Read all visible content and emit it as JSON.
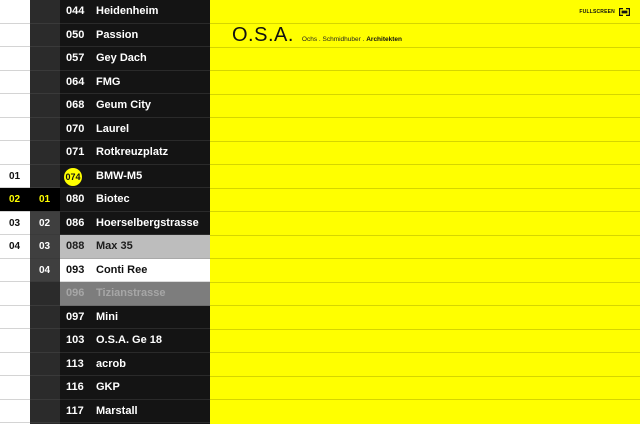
{
  "index_col1": [
    "01",
    "02",
    "03",
    "04"
  ],
  "index_col2": [
    "01",
    "02",
    "03",
    "04"
  ],
  "projects": [
    {
      "num": "044",
      "name": "Heidenheim"
    },
    {
      "num": "050",
      "name": "Passion"
    },
    {
      "num": "057",
      "name": "Gey Dach"
    },
    {
      "num": "064",
      "name": "FMG"
    },
    {
      "num": "068",
      "name": "Geum City"
    },
    {
      "num": "070",
      "name": "Laurel"
    },
    {
      "num": "071",
      "name": "Rotkreuzplatz"
    },
    {
      "num": "074",
      "name": "BMW-M5"
    },
    {
      "num": "080",
      "name": "Biotec"
    },
    {
      "num": "086",
      "name": "Hoerselbergstrasse"
    },
    {
      "num": "088",
      "name": "Max 35"
    },
    {
      "num": "093",
      "name": "Conti Ree"
    },
    {
      "num": "096",
      "name": "Tizianstrasse"
    },
    {
      "num": "097",
      "name": "Mini"
    },
    {
      "num": "103",
      "name": "O.S.A. Ge 18"
    },
    {
      "num": "113",
      "name": "acrob"
    },
    {
      "num": "116",
      "name": "GKP"
    },
    {
      "num": "117",
      "name": "Marstall"
    }
  ],
  "header": {
    "logo": "O.S.A.",
    "subtitle_part1": "Ochs . Schmidhuber . ",
    "subtitle_part2": "Architekten",
    "fullscreen_label": "FULLSCREEN"
  },
  "colors": {
    "accent": "#ffff00",
    "list_bg": "#141414"
  }
}
